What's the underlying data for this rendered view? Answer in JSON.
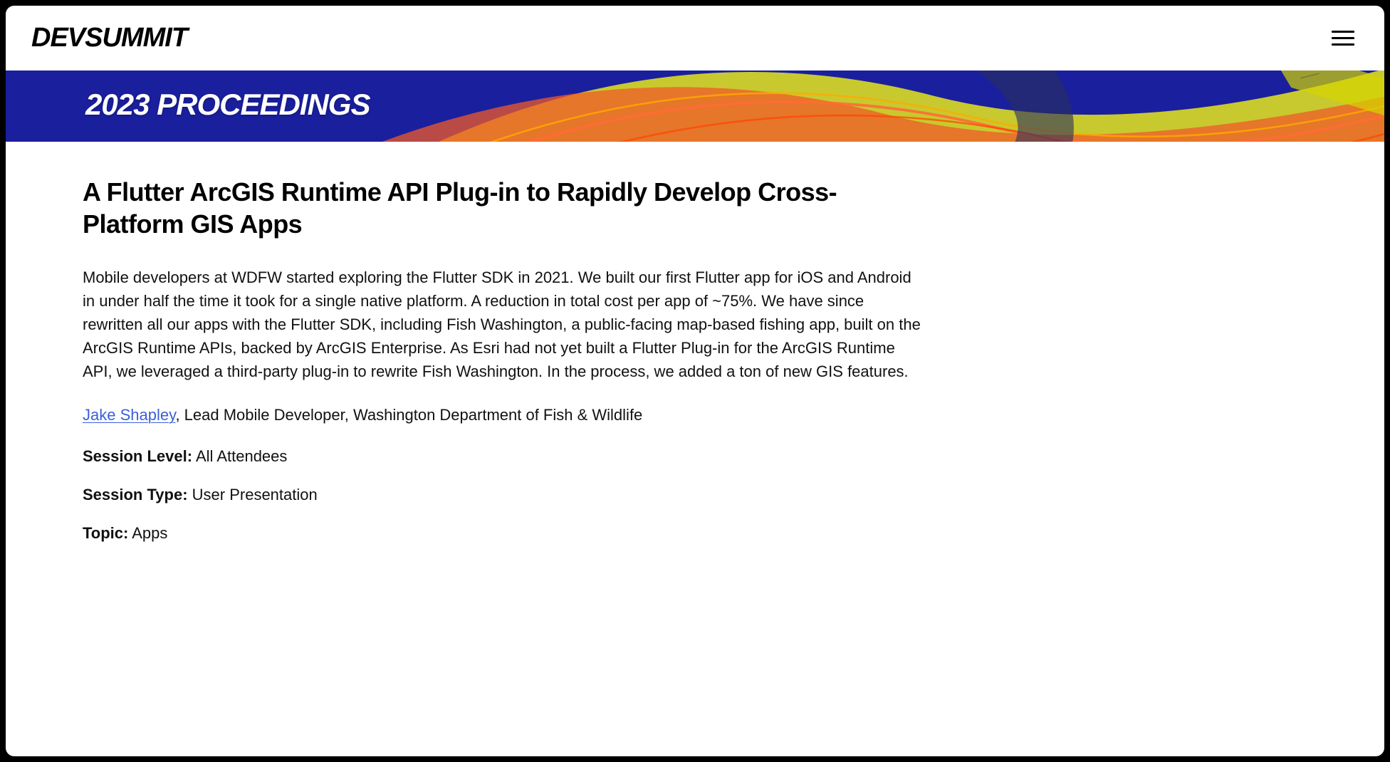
{
  "header": {
    "logo": "DEVSUMMIT"
  },
  "banner": {
    "title": "2023 PROCEEDINGS"
  },
  "main": {
    "title": "A Flutter ArcGIS Runtime API Plug-in to Rapidly Develop Cross-Platform GIS Apps",
    "description": "Mobile developers at WDFW started exploring the Flutter SDK in 2021. We built our first Flutter app for iOS and Android in under half the time it took for a single native platform. A reduction in total cost per app of ~75%. We have since rewritten all our apps with the Flutter SDK, including Fish Washington, a public-facing map-based fishing app, built on the ArcGIS Runtime APIs, backed by ArcGIS Enterprise. As Esri had not yet built a Flutter Plug-in for the ArcGIS Runtime API, we leveraged a third-party plug-in to rewrite Fish Washington. In the process, we added a ton of new GIS features.",
    "author": {
      "name": "Jake Shapley",
      "role": ", Lead Mobile Developer, Washington Department of Fish & Wildlife"
    },
    "meta": {
      "session_level_label": "Session Level:",
      "session_level_value": " All Attendees",
      "session_type_label": "Session Type:",
      "session_type_value": " User Presentation",
      "topic_label": "Topic:",
      "topic_value": " Apps"
    }
  }
}
